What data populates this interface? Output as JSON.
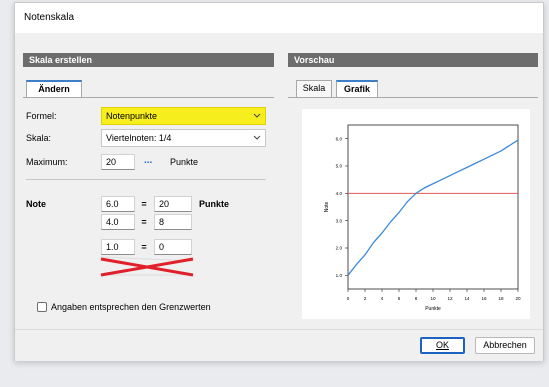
{
  "window": {
    "title": "Notenskala"
  },
  "left": {
    "header": "Skala erstellen",
    "tab": "Ändern",
    "formel_label": "Formel:",
    "formel_value": "Notenpunkte",
    "skala_label": "Skala:",
    "skala_value": "Viertelnoten: 1/4",
    "maximum_label": "Maximum:",
    "maximum_value": "20",
    "maximum_dots": "...",
    "maximum_unit": "Punkte",
    "note_label": "Note",
    "punkte_label": "Punkte",
    "rows": [
      {
        "note": "6.0",
        "eq": "=",
        "punkte": "20"
      },
      {
        "note": "4.0",
        "eq": "=",
        "punkte": "8"
      },
      {
        "note": "1.0",
        "eq": "=",
        "punkte": "0"
      }
    ],
    "checkbox_label": "Angaben entsprechen den Grenzwerten",
    "checkbox_checked": false
  },
  "right": {
    "header": "Vorschau",
    "tabs": [
      "Skala",
      "Grafik"
    ],
    "active_tab": "Grafik"
  },
  "buttons": {
    "ok": "OK",
    "cancel": "Abbrechen"
  },
  "colors": {
    "highlight": "#f7ee1e",
    "accent": "#3c7fc8",
    "series": "#3b8ad8",
    "threshold": "#e05a5a",
    "cross": "#e0202a"
  },
  "chart_data": {
    "type": "line",
    "xlabel": "Punkte",
    "ylabel": "Note",
    "xlim": [
      0,
      20
    ],
    "ylim": [
      0.5,
      6.5
    ],
    "xticks": [
      "0",
      "2",
      "4",
      "6",
      "8",
      "10",
      "12",
      "14",
      "16",
      "18",
      "20"
    ],
    "yticks": [
      "1.0",
      "2.0",
      "3.0",
      "4.0",
      "5.0",
      "6.0"
    ],
    "series": [
      {
        "x": [
          0,
          1,
          2,
          3,
          4,
          5,
          6,
          7,
          8,
          9,
          10,
          11,
          12,
          13,
          14,
          15,
          16,
          17,
          18,
          19,
          20
        ],
        "y": [
          1.0,
          1.4,
          1.75,
          2.2,
          2.55,
          2.95,
          3.3,
          3.7,
          4.0,
          4.2,
          4.35,
          4.5,
          4.65,
          4.8,
          4.95,
          5.1,
          5.25,
          5.4,
          5.55,
          5.75,
          5.95
        ]
      }
    ],
    "threshold": {
      "y": 4.0
    }
  }
}
